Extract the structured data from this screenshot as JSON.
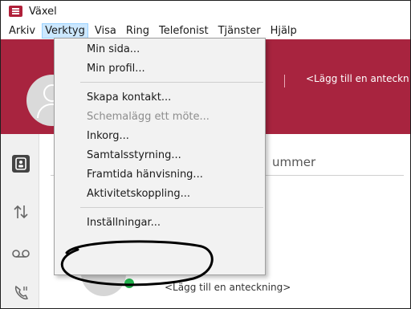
{
  "window": {
    "title": "Växel",
    "accent": "#a8243f"
  },
  "menubar": {
    "items": [
      {
        "label": "Arkiv",
        "active": false
      },
      {
        "label": "Verktyg",
        "active": true
      },
      {
        "label": "Visa",
        "active": false
      },
      {
        "label": "Ring",
        "active": false
      },
      {
        "label": "Telefonist",
        "active": false
      },
      {
        "label": "Tjänster",
        "active": false
      },
      {
        "label": "Hjälp",
        "active": false
      }
    ]
  },
  "header": {
    "note": "<Lägg till en anteckn"
  },
  "search": {
    "text": "ummer"
  },
  "contact": {
    "name": "...",
    "note": "<Lägg till en anteckning>",
    "presence": "#22b14c"
  },
  "dropdown": {
    "items": [
      {
        "label": "Min sida...",
        "enabled": true
      },
      {
        "label": "Min profil...",
        "enabled": true
      },
      {
        "label": "Skapa kontakt...",
        "enabled": true
      },
      {
        "label": "Schemalägg ett möte...",
        "enabled": false
      },
      {
        "label": "Inkorg...",
        "enabled": true
      },
      {
        "label": "Samtalsstyrning...",
        "enabled": true
      },
      {
        "label": "Framtida hänvisning...",
        "enabled": true
      },
      {
        "label": "Aktivitetskoppling...",
        "enabled": true
      },
      {
        "label": "Inställningar...",
        "enabled": true
      }
    ]
  },
  "rail": {
    "icons": [
      "contacts-icon",
      "transfer-arrows-icon",
      "voicemail-icon",
      "call-log-icon"
    ]
  }
}
